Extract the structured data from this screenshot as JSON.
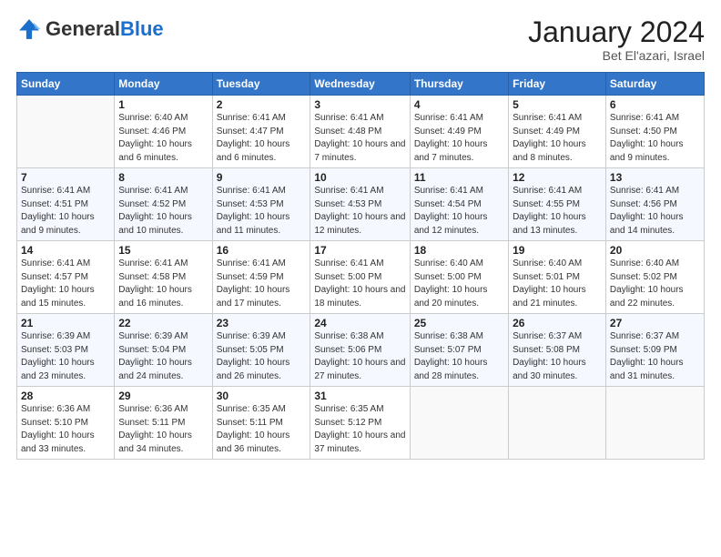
{
  "logo": {
    "general": "General",
    "blue": "Blue"
  },
  "header": {
    "title": "January 2024",
    "location": "Bet El'azari, Israel"
  },
  "weekdays": [
    "Sunday",
    "Monday",
    "Tuesday",
    "Wednesday",
    "Thursday",
    "Friday",
    "Saturday"
  ],
  "weeks": [
    [
      {
        "day": "",
        "sunrise": "",
        "sunset": "",
        "daylight": ""
      },
      {
        "day": "1",
        "sunrise": "Sunrise: 6:40 AM",
        "sunset": "Sunset: 4:46 PM",
        "daylight": "Daylight: 10 hours and 6 minutes."
      },
      {
        "day": "2",
        "sunrise": "Sunrise: 6:41 AM",
        "sunset": "Sunset: 4:47 PM",
        "daylight": "Daylight: 10 hours and 6 minutes."
      },
      {
        "day": "3",
        "sunrise": "Sunrise: 6:41 AM",
        "sunset": "Sunset: 4:48 PM",
        "daylight": "Daylight: 10 hours and 7 minutes."
      },
      {
        "day": "4",
        "sunrise": "Sunrise: 6:41 AM",
        "sunset": "Sunset: 4:49 PM",
        "daylight": "Daylight: 10 hours and 7 minutes."
      },
      {
        "day": "5",
        "sunrise": "Sunrise: 6:41 AM",
        "sunset": "Sunset: 4:49 PM",
        "daylight": "Daylight: 10 hours and 8 minutes."
      },
      {
        "day": "6",
        "sunrise": "Sunrise: 6:41 AM",
        "sunset": "Sunset: 4:50 PM",
        "daylight": "Daylight: 10 hours and 9 minutes."
      }
    ],
    [
      {
        "day": "7",
        "sunrise": "Sunrise: 6:41 AM",
        "sunset": "Sunset: 4:51 PM",
        "daylight": "Daylight: 10 hours and 9 minutes."
      },
      {
        "day": "8",
        "sunrise": "Sunrise: 6:41 AM",
        "sunset": "Sunset: 4:52 PM",
        "daylight": "Daylight: 10 hours and 10 minutes."
      },
      {
        "day": "9",
        "sunrise": "Sunrise: 6:41 AM",
        "sunset": "Sunset: 4:53 PM",
        "daylight": "Daylight: 10 hours and 11 minutes."
      },
      {
        "day": "10",
        "sunrise": "Sunrise: 6:41 AM",
        "sunset": "Sunset: 4:53 PM",
        "daylight": "Daylight: 10 hours and 12 minutes."
      },
      {
        "day": "11",
        "sunrise": "Sunrise: 6:41 AM",
        "sunset": "Sunset: 4:54 PM",
        "daylight": "Daylight: 10 hours and 12 minutes."
      },
      {
        "day": "12",
        "sunrise": "Sunrise: 6:41 AM",
        "sunset": "Sunset: 4:55 PM",
        "daylight": "Daylight: 10 hours and 13 minutes."
      },
      {
        "day": "13",
        "sunrise": "Sunrise: 6:41 AM",
        "sunset": "Sunset: 4:56 PM",
        "daylight": "Daylight: 10 hours and 14 minutes."
      }
    ],
    [
      {
        "day": "14",
        "sunrise": "Sunrise: 6:41 AM",
        "sunset": "Sunset: 4:57 PM",
        "daylight": "Daylight: 10 hours and 15 minutes."
      },
      {
        "day": "15",
        "sunrise": "Sunrise: 6:41 AM",
        "sunset": "Sunset: 4:58 PM",
        "daylight": "Daylight: 10 hours and 16 minutes."
      },
      {
        "day": "16",
        "sunrise": "Sunrise: 6:41 AM",
        "sunset": "Sunset: 4:59 PM",
        "daylight": "Daylight: 10 hours and 17 minutes."
      },
      {
        "day": "17",
        "sunrise": "Sunrise: 6:41 AM",
        "sunset": "Sunset: 5:00 PM",
        "daylight": "Daylight: 10 hours and 18 minutes."
      },
      {
        "day": "18",
        "sunrise": "Sunrise: 6:40 AM",
        "sunset": "Sunset: 5:00 PM",
        "daylight": "Daylight: 10 hours and 20 minutes."
      },
      {
        "day": "19",
        "sunrise": "Sunrise: 6:40 AM",
        "sunset": "Sunset: 5:01 PM",
        "daylight": "Daylight: 10 hours and 21 minutes."
      },
      {
        "day": "20",
        "sunrise": "Sunrise: 6:40 AM",
        "sunset": "Sunset: 5:02 PM",
        "daylight": "Daylight: 10 hours and 22 minutes."
      }
    ],
    [
      {
        "day": "21",
        "sunrise": "Sunrise: 6:39 AM",
        "sunset": "Sunset: 5:03 PM",
        "daylight": "Daylight: 10 hours and 23 minutes."
      },
      {
        "day": "22",
        "sunrise": "Sunrise: 6:39 AM",
        "sunset": "Sunset: 5:04 PM",
        "daylight": "Daylight: 10 hours and 24 minutes."
      },
      {
        "day": "23",
        "sunrise": "Sunrise: 6:39 AM",
        "sunset": "Sunset: 5:05 PM",
        "daylight": "Daylight: 10 hours and 26 minutes."
      },
      {
        "day": "24",
        "sunrise": "Sunrise: 6:38 AM",
        "sunset": "Sunset: 5:06 PM",
        "daylight": "Daylight: 10 hours and 27 minutes."
      },
      {
        "day": "25",
        "sunrise": "Sunrise: 6:38 AM",
        "sunset": "Sunset: 5:07 PM",
        "daylight": "Daylight: 10 hours and 28 minutes."
      },
      {
        "day": "26",
        "sunrise": "Sunrise: 6:37 AM",
        "sunset": "Sunset: 5:08 PM",
        "daylight": "Daylight: 10 hours and 30 minutes."
      },
      {
        "day": "27",
        "sunrise": "Sunrise: 6:37 AM",
        "sunset": "Sunset: 5:09 PM",
        "daylight": "Daylight: 10 hours and 31 minutes."
      }
    ],
    [
      {
        "day": "28",
        "sunrise": "Sunrise: 6:36 AM",
        "sunset": "Sunset: 5:10 PM",
        "daylight": "Daylight: 10 hours and 33 minutes."
      },
      {
        "day": "29",
        "sunrise": "Sunrise: 6:36 AM",
        "sunset": "Sunset: 5:11 PM",
        "daylight": "Daylight: 10 hours and 34 minutes."
      },
      {
        "day": "30",
        "sunrise": "Sunrise: 6:35 AM",
        "sunset": "Sunset: 5:11 PM",
        "daylight": "Daylight: 10 hours and 36 minutes."
      },
      {
        "day": "31",
        "sunrise": "Sunrise: 6:35 AM",
        "sunset": "Sunset: 5:12 PM",
        "daylight": "Daylight: 10 hours and 37 minutes."
      },
      {
        "day": "",
        "sunrise": "",
        "sunset": "",
        "daylight": ""
      },
      {
        "day": "",
        "sunrise": "",
        "sunset": "",
        "daylight": ""
      },
      {
        "day": "",
        "sunrise": "",
        "sunset": "",
        "daylight": ""
      }
    ]
  ]
}
